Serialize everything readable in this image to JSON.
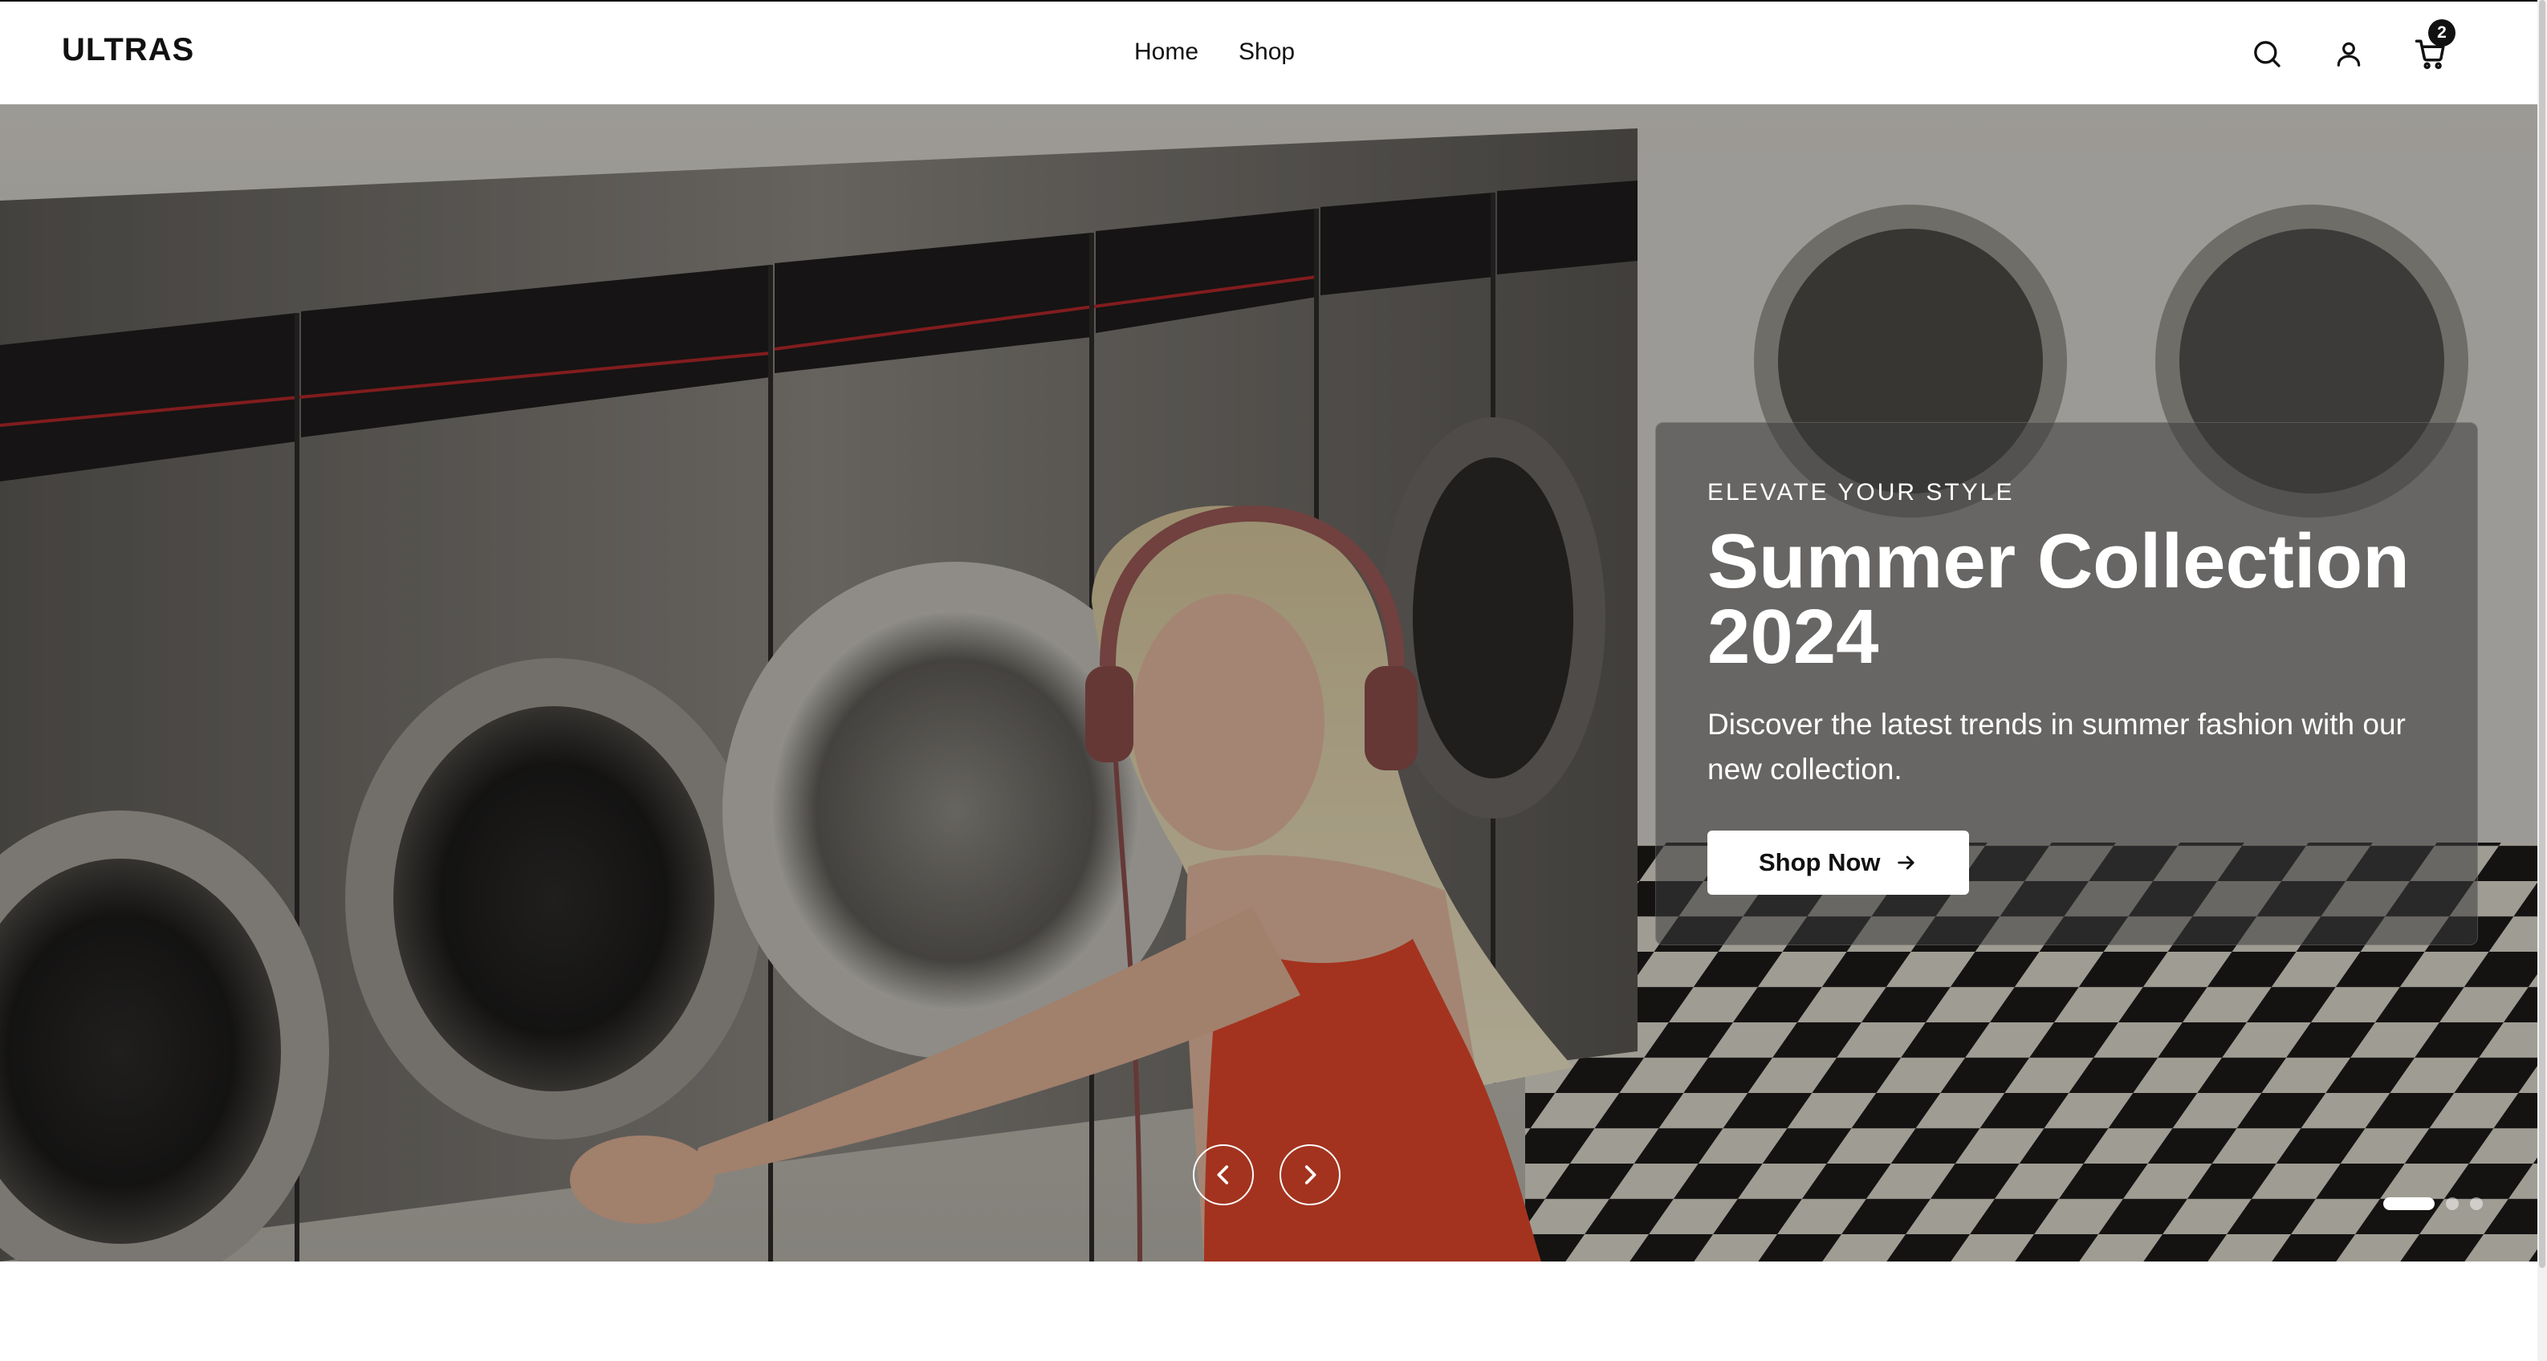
{
  "brand": {
    "logo": "ULTRAS"
  },
  "nav": {
    "items": [
      {
        "label": "Home"
      },
      {
        "label": "Shop"
      }
    ]
  },
  "header": {
    "icons": [
      "search-icon",
      "user-icon",
      "cart-icon"
    ],
    "cart_count": "2"
  },
  "hero": {
    "eyebrow": "ELEVATE YOUR STYLE",
    "title": "Summer Collection 2024",
    "description": "Discover the latest trends in summer fashion with our new collection.",
    "cta_label": "Shop Now",
    "slides_total": 3,
    "active_slide": 1
  },
  "colors": {
    "text_dark": "#111111",
    "white": "#ffffff",
    "accent_top": "#e05a2b"
  }
}
